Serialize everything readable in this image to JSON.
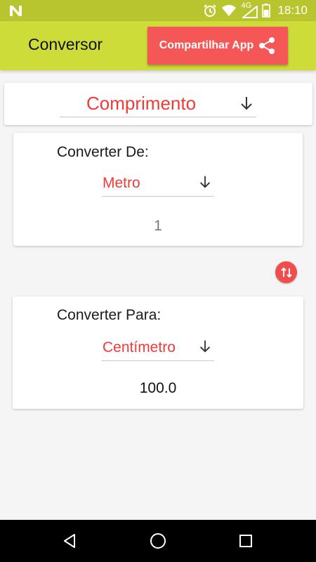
{
  "status_bar": {
    "time": "18:10",
    "network_label": "4G",
    "background_color": "#b9c52e",
    "icons": [
      "n-notification-icon",
      "alarm-icon",
      "wifi-icon",
      "signal-icon",
      "battery-icon"
    ]
  },
  "app_bar": {
    "title": "Conversor",
    "share_label": "Compartilhar App",
    "background_color": "#cddc39",
    "share_color": "#f55757"
  },
  "category": {
    "selected": "Comprimento"
  },
  "from": {
    "label": "Converter De:",
    "unit": "Metro",
    "value": "1"
  },
  "to": {
    "label": "Converter Para:",
    "unit": "Centímetro",
    "value": "100.0"
  },
  "accent_color": "#f03a3a",
  "nav_bar": {
    "icons": [
      "back-icon",
      "home-icon",
      "recent-apps-icon"
    ]
  }
}
